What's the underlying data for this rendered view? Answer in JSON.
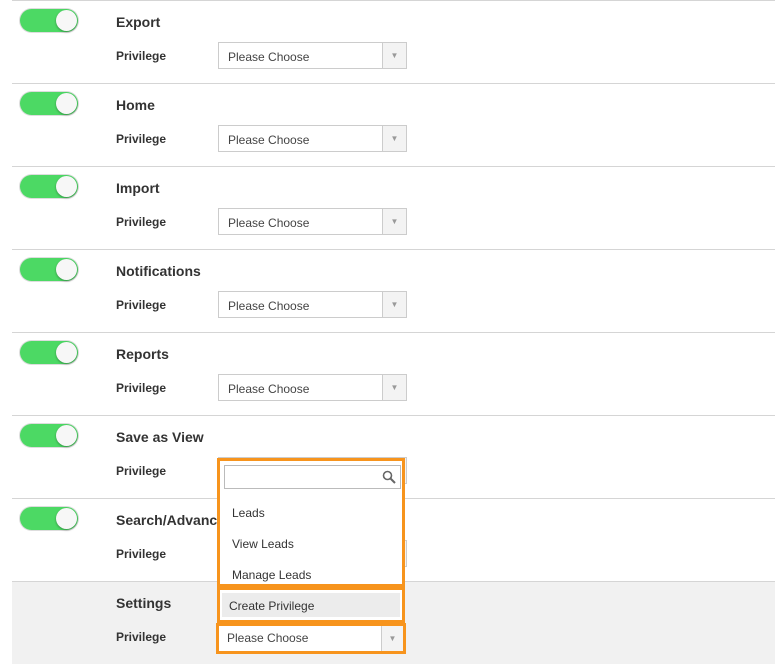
{
  "modules": [
    {
      "title": "Export",
      "enabled": true
    },
    {
      "title": "Home",
      "enabled": true
    },
    {
      "title": "Import",
      "enabled": true
    },
    {
      "title": "Notifications",
      "enabled": true
    },
    {
      "title": "Reports",
      "enabled": true
    },
    {
      "title": "Save as View",
      "enabled": true
    },
    {
      "title": "Search/Advanc",
      "enabled": true
    },
    {
      "title": "Settings",
      "enabled": false
    }
  ],
  "privilege_label": "Privilege",
  "select_placeholder": "Please Choose",
  "dropdown": {
    "search_value": "",
    "options": [
      "Leads",
      "View Leads",
      "Manage Leads"
    ],
    "create_label": "Create Privilege"
  },
  "colors": {
    "toggle_on": "#4cd964",
    "highlight": "#f7941d"
  }
}
